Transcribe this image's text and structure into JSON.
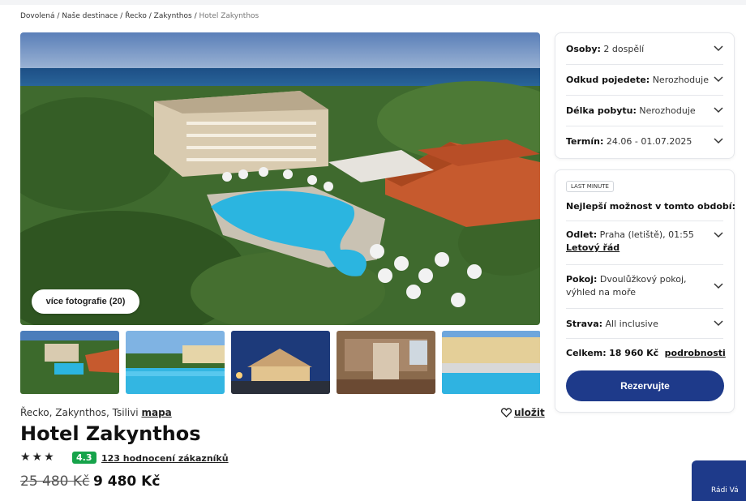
{
  "breadcrumb": {
    "items": [
      "Dovolená",
      "Naše destinace",
      "Řecko",
      "Zakynthos"
    ],
    "current": "Hotel Zakynthos",
    "separator": "/"
  },
  "gallery": {
    "more_photos_label": "více fotografie (20)",
    "thumbnail_count": 5
  },
  "hotel": {
    "location": "Řecko, Zakynthos, Tsilivi",
    "map_link": "mapa",
    "save_label": "uložit",
    "name": "Hotel Zakynthos",
    "stars": "★★★",
    "rating": "4.3",
    "reviews_label": "123 hodnocení zákazníků",
    "price_old": "25 480 Kč",
    "price_new": "9 480 Kč"
  },
  "filters": [
    {
      "label": "Osoby:",
      "value": "2 dospělí"
    },
    {
      "label": "Odkud pojedete:",
      "value": "Nerozhoduje"
    },
    {
      "label": "Délka pobytu:",
      "value": "Nerozhoduje"
    },
    {
      "label": "Termín:",
      "value": "24.06 - 01.07.2025"
    }
  ],
  "offer": {
    "badge": "LAST MINUTE",
    "heading": "Nejlepší možnost v tomto období:",
    "departure_label": "Odlet:",
    "departure_value": "Praha (letiště), 01:55",
    "schedule_link": "Letový řád",
    "room_label": "Pokoj:",
    "room_value": "Dvoulůžkový pokoj, výhled na moře",
    "board_label": "Strava:",
    "board_value": "All inclusive",
    "total_label": "Celkem:",
    "total_value": "18 960 Kč",
    "details_link": "podrobnosti",
    "reserve_label": "Rezervujte"
  },
  "chat": {
    "label": "Rádi Vá"
  },
  "colors": {
    "primary": "#1e3a8a",
    "rating": "#16a34a"
  }
}
